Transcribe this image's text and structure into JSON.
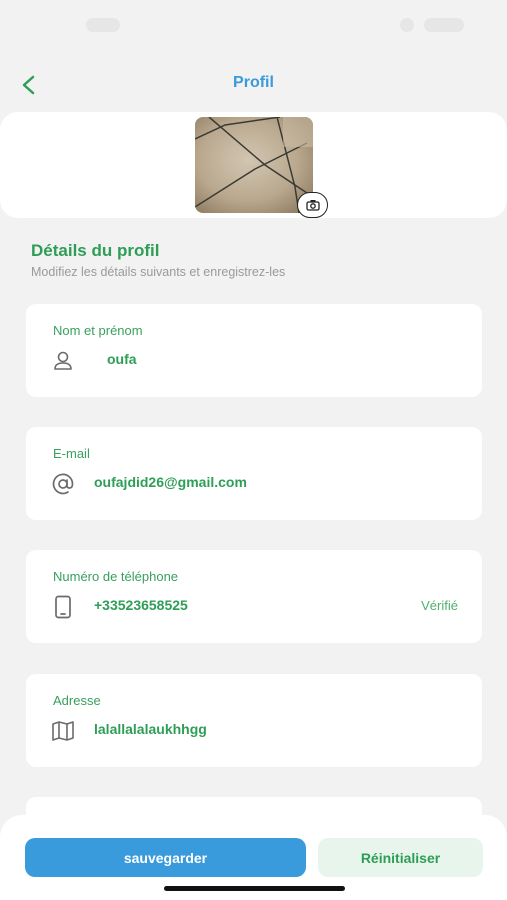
{
  "header": {
    "title": "Profil",
    "back_icon": "chevron-left-icon"
  },
  "avatar": {
    "camera_icon": "camera-icon"
  },
  "section": {
    "title": "Détails du profil",
    "subtitle": "Modifiez les détails suivants et enregistrez-les"
  },
  "fields": [
    {
      "label": "Nom et prénom",
      "value": "oufa",
      "icon": "user-icon"
    },
    {
      "label": "E-mail",
      "value": "oufajdid26@gmail.com",
      "icon": "at-icon"
    },
    {
      "label": "Numéro de téléphone",
      "value": "+33523658525",
      "icon": "phone-icon",
      "status": "Vérifié"
    },
    {
      "label": "Adresse",
      "value": "lalallalalaukhhgg",
      "icon": "map-icon"
    }
  ],
  "actions": {
    "save_label": "sauvegarder",
    "reset_label": "Réinitialiser"
  },
  "colors": {
    "accent_blue": "#3a9bdc",
    "accent_green": "#2e9e57",
    "background": "#f2f2f2",
    "card": "#ffffff"
  }
}
